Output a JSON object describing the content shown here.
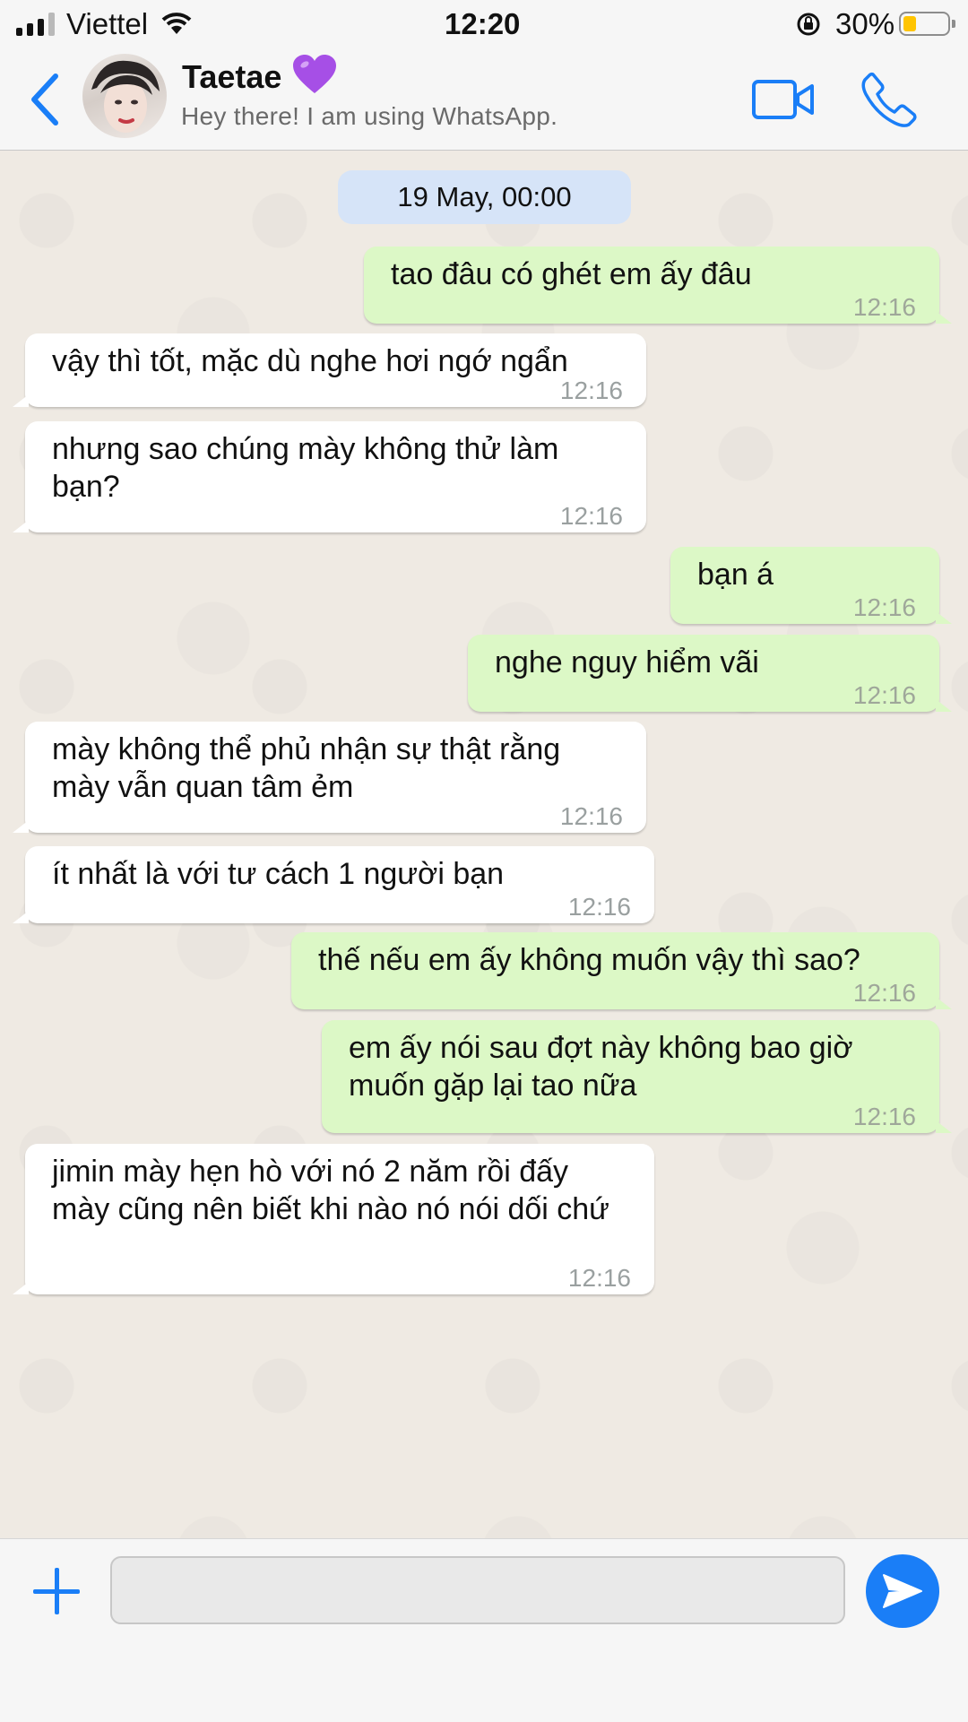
{
  "status_bar": {
    "carrier": "Viettel",
    "time": "12:20",
    "battery_percent": "30%",
    "battery_level": 0.3
  },
  "header": {
    "contact_name": "Taetae",
    "contact_status": "Hey there! I am using WhatsApp.",
    "back_icon": "chevron-left-icon",
    "video_icon": "video-camera-icon",
    "call_icon": "phone-icon",
    "accent_color": "#1a7ef7"
  },
  "chat": {
    "date_label": "19 May, 00:00",
    "messages": [
      {
        "direction": "out",
        "text": "tao đâu có ghét em ấy đâu",
        "time": "12:16"
      },
      {
        "direction": "in",
        "text": "vậy thì tốt, mặc dù nghe hơi ngớ ngẩn",
        "time": "12:16"
      },
      {
        "direction": "in",
        "text": "nhưng sao chúng mày không thử làm bạn?",
        "time": "12:16"
      },
      {
        "direction": "out",
        "text": "bạn á",
        "time": "12:16"
      },
      {
        "direction": "out",
        "text": "nghe nguy hiểm vãi",
        "time": "12:16"
      },
      {
        "direction": "in",
        "text": "mày không thể phủ nhận sự thật rằng mày vẫn quan tâm ẻm",
        "time": "12:16"
      },
      {
        "direction": "in",
        "text": "ít nhất là với tư cách 1 người bạn",
        "time": "12:16"
      },
      {
        "direction": "out",
        "text": "thế nếu em ấy không muốn vậy thì sao?",
        "time": "12:16"
      },
      {
        "direction": "out",
        "text": "em ấy nói sau đợt này không bao giờ muốn gặp lại tao nữa",
        "time": "12:16"
      },
      {
        "direction": "in",
        "text": "jimin mày hẹn hò với nó 2 năm rồi đấy mày cũng nên biết khi nào nó nói dối chứ",
        "time": "12:16"
      }
    ],
    "incoming_color": "#ffffff",
    "outgoing_color": "#dcf8c6"
  },
  "input_bar": {
    "message_value": "",
    "plus_icon": "plus-icon",
    "send_icon": "send-icon"
  }
}
